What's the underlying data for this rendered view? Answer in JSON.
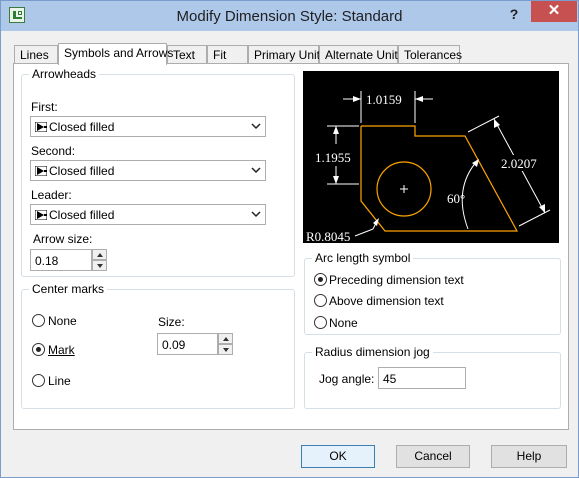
{
  "window": {
    "title": "Modify Dimension Style: Standard",
    "help_glyph": "?",
    "close_glyph": "✕"
  },
  "tabs": [
    {
      "label": "Lines"
    },
    {
      "label": "Symbols and Arrows"
    },
    {
      "label": "Text"
    },
    {
      "label": "Fit"
    },
    {
      "label": "Primary Units"
    },
    {
      "label": "Alternate Units"
    },
    {
      "label": "Tolerances"
    }
  ],
  "arrowheads": {
    "title": "Arrowheads",
    "first_label": "First:",
    "first_value": "Closed filled",
    "second_label": "Second:",
    "second_value": "Closed filled",
    "leader_label": "Leader:",
    "leader_value": "Closed filled",
    "arrow_size_label": "Arrow size:",
    "arrow_size_value": "0.18"
  },
  "center_marks": {
    "title": "Center marks",
    "none_label": "None",
    "mark_label": "Mark",
    "line_label": "Line",
    "size_label": "Size:",
    "size_value": "0.09",
    "selected": "Mark"
  },
  "preview": {
    "dim_top": "1.0159",
    "dim_left": "1.1955",
    "dim_right": "2.0207",
    "angle": "60°",
    "radius": "R0.8045",
    "geometry_color": "#ffa500",
    "dim_color": "#ffffff"
  },
  "arc_length": {
    "title": "Arc length symbol",
    "preceding_label": "Preceding dimension text",
    "above_label": "Above dimension text",
    "none_label": "None",
    "selected": "Preceding dimension text"
  },
  "radius_jog": {
    "title": "Radius dimension jog",
    "jog_angle_label": "Jog angle:",
    "jog_angle_value": "45"
  },
  "buttons": {
    "ok": "OK",
    "cancel": "Cancel",
    "help": "Help"
  },
  "colors": {
    "titlebar": "#aec8ea",
    "close_button": "#c75050",
    "group_border": "#d5dfe5"
  }
}
